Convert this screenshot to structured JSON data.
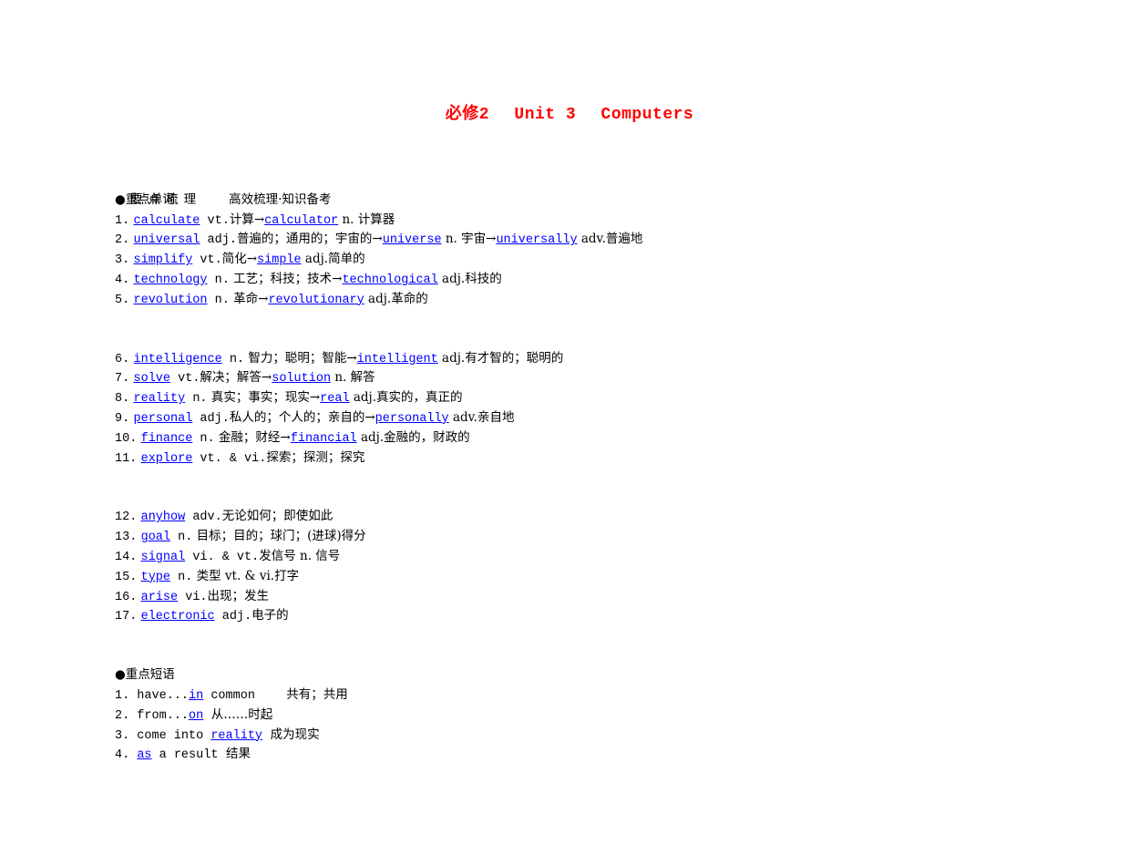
{
  "title": {
    "part1": "必修2",
    "part2": "Unit 3",
    "part3": "Computers"
  },
  "header": {
    "left": "要点梳理",
    "right": "高效梳理·知识备考"
  },
  "words_section": {
    "heading": "●重点单词",
    "groups": [
      [
        {
          "num": "1.",
          "word": "calculate",
          "pos": " vt.",
          "meaning": "计算→",
          "word2": "calculator",
          "rest": " n. 计算器"
        },
        {
          "num": "2.",
          "word": "universal",
          "pos": " adj.",
          "meaning": "普遍的；通用的；宇宙的→",
          "word2": "universe",
          "rest": " n. 宇宙→",
          "word3": "universally",
          "rest2": " adv.普遍地"
        },
        {
          "num": "3.",
          "word": "simplify",
          "pos": " vt.",
          "meaning": "简化→",
          "word2": "simple",
          "rest": " adj.简单的"
        },
        {
          "num": "4.",
          "word": "technology",
          "pos": " n.",
          "meaning": " 工艺；科技；技术→",
          "word2": "technological",
          "rest": " adj.科技的"
        },
        {
          "num": "5.",
          "word": "revolution",
          "pos": " n.",
          "meaning": " 革命→",
          "word2": "revolutionary",
          "rest": " adj.革命的"
        }
      ],
      [
        {
          "num": "6.",
          "word": "intelligence",
          "pos": " n.",
          "meaning": " 智力；聪明；智能→",
          "word2": "intelligent",
          "rest": " adj.有才智的；聪明的"
        },
        {
          "num": "7.",
          "word": "solve",
          "pos": " vt.",
          "meaning": "解决；解答→",
          "word2": "solution",
          "rest": " n. 解答"
        },
        {
          "num": "8.",
          "word": "reality",
          "pos": " n.",
          "meaning": " 真实；事实；现实→",
          "word2": "real",
          "rest": " adj.真实的，真正的"
        },
        {
          "num": "9.",
          "word": "personal",
          "pos": " adj.",
          "meaning": "私人的；个人的；亲自的→",
          "word2": "personally",
          "rest": " adv.亲自地"
        },
        {
          "num": "10.",
          "word": "finance",
          "pos": " n.",
          "meaning": " 金融；财经→",
          "word2": "financial",
          "rest": " adj.金融的，财政的"
        },
        {
          "num": "11.",
          "word": "explore",
          "pos": " vt. & vi.",
          "meaning": "探索；探测；探究"
        }
      ],
      [
        {
          "num": "12.",
          "word": "anyhow",
          "pos": " adv.",
          "meaning": "无论如何；即使如此"
        },
        {
          "num": "13.",
          "word": "goal",
          "pos": " n.",
          "meaning": " 目标；目的；球门；(进球)得分"
        },
        {
          "num": "14.",
          "word": "signal",
          "pos": " vi. & vt.",
          "meaning": "发信号 n. 信号"
        },
        {
          "num": "15.",
          "word": "type",
          "pos": " n.",
          "meaning": " 类型 vt. & vi.打字"
        },
        {
          "num": "16.",
          "word": "arise",
          "pos": " vi.",
          "meaning": "出现；发生"
        },
        {
          "num": "17.",
          "word": "electronic",
          "pos": " adj.",
          "meaning": "电子的"
        }
      ]
    ]
  },
  "phrases_section": {
    "heading": "●重点短语",
    "items": [
      {
        "num": "1.",
        "before": " have...",
        "link": "in",
        "after": " common",
        "meaning": "        共有；共用"
      },
      {
        "num": "2.",
        "before": " from...",
        "link": "on",
        "after": "",
        "meaning": "  从……时起"
      },
      {
        "num": "3.",
        "before": " come into ",
        "link": "reality",
        "after": "",
        "meaning": "  成为现实"
      },
      {
        "num": "4.",
        "before": " ",
        "link": "as",
        "after": " a result",
        "meaning": "  结果"
      }
    ]
  }
}
